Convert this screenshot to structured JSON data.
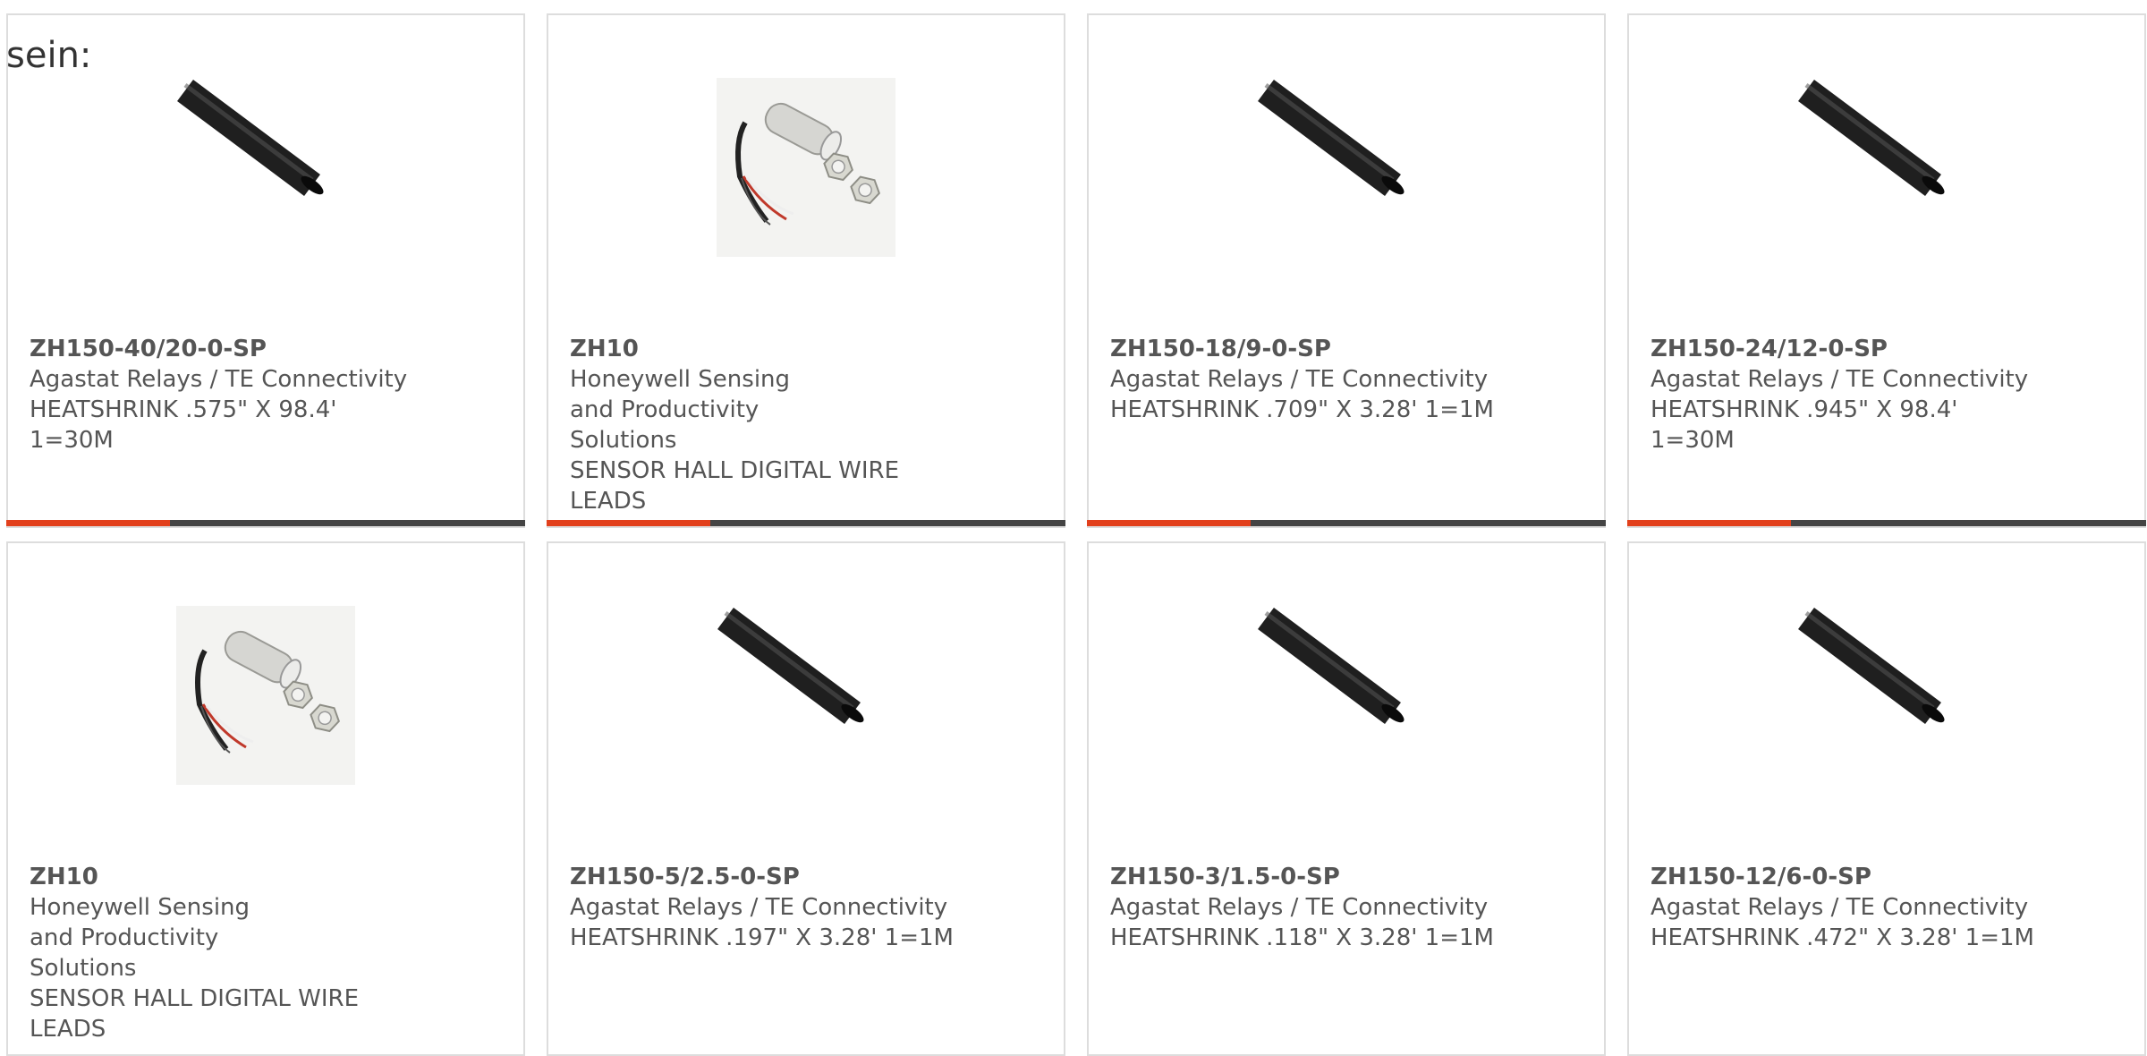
{
  "intro_text": "sein:",
  "colors": {
    "accent": "#e2401c",
    "bar": "#444444",
    "text": "#555555",
    "border": "#dddddd"
  },
  "products": [
    {
      "part": "ZH150-40/20-0-SP",
      "maker": "Agastat Relays / TE Connectivity",
      "desc": "HEATSHRINK .575\" X 98.4' 1=30M",
      "image": "heatshrink-tube"
    },
    {
      "part": "ZH10",
      "maker": "Honeywell Sensing and Productivity Solutions",
      "desc": "SENSOR HALL DIGITAL WIRE LEADS",
      "image": "hall-sensor"
    },
    {
      "part": "ZH150-18/9-0-SP",
      "maker": "Agastat Relays / TE Connectivity",
      "desc": "HEATSHRINK .709\" X 3.28' 1=1M",
      "image": "heatshrink-tube"
    },
    {
      "part": "ZH150-24/12-0-SP",
      "maker": "Agastat Relays / TE Connectivity",
      "desc": "HEATSHRINK .945\" X 98.4' 1=30M",
      "image": "heatshrink-tube"
    },
    {
      "part": "ZH10",
      "maker": "Honeywell Sensing and Productivity Solutions",
      "desc": "SENSOR HALL DIGITAL WIRE LEADS",
      "image": "hall-sensor"
    },
    {
      "part": "ZH150-5/2.5-0-SP",
      "maker": "Agastat Relays / TE Connectivity",
      "desc": "HEATSHRINK .197\" X 3.28' 1=1M",
      "image": "heatshrink-tube"
    },
    {
      "part": "ZH150-3/1.5-0-SP",
      "maker": "Agastat Relays / TE Connectivity",
      "desc": "HEATSHRINK .118\" X 3.28' 1=1M",
      "image": "heatshrink-tube"
    },
    {
      "part": "ZH150-12/6-0-SP",
      "maker": "Agastat Relays / TE Connectivity",
      "desc": "HEATSHRINK .472\" X 3.28' 1=1M",
      "image": "heatshrink-tube"
    }
  ]
}
